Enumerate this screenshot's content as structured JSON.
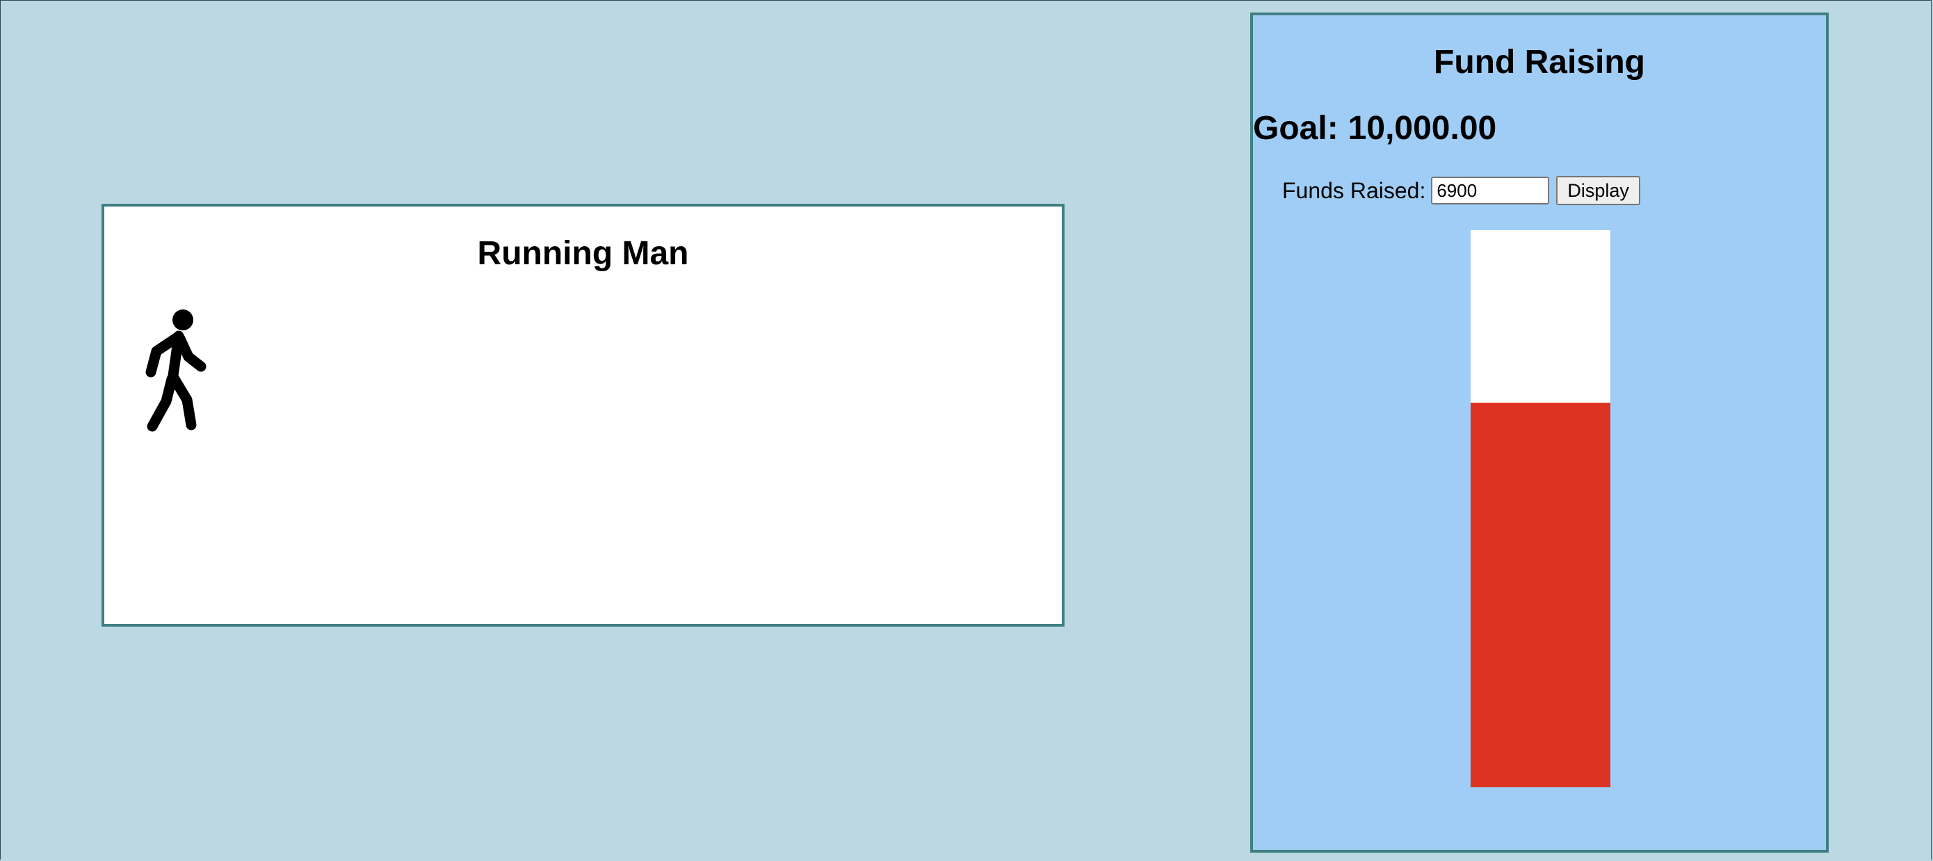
{
  "running_man": {
    "title": "Running Man",
    "figure_icon": "walking-person-icon"
  },
  "fund_raising": {
    "title": "Fund Raising",
    "goal_label": "Goal:",
    "goal_value": "10,000.00",
    "funds_label": "Funds Raised:",
    "funds_value": "6900",
    "display_button_label": "Display",
    "goal_amount": 10000,
    "raised_amount": 6900,
    "progress_fraction": 0.69,
    "fill_color": "#dd3322",
    "empty_color": "#ffffff"
  },
  "colors": {
    "page_background": "#bbd8e3",
    "fund_panel_background": "#a0cdf5",
    "panel_border": "#3f7f84"
  }
}
